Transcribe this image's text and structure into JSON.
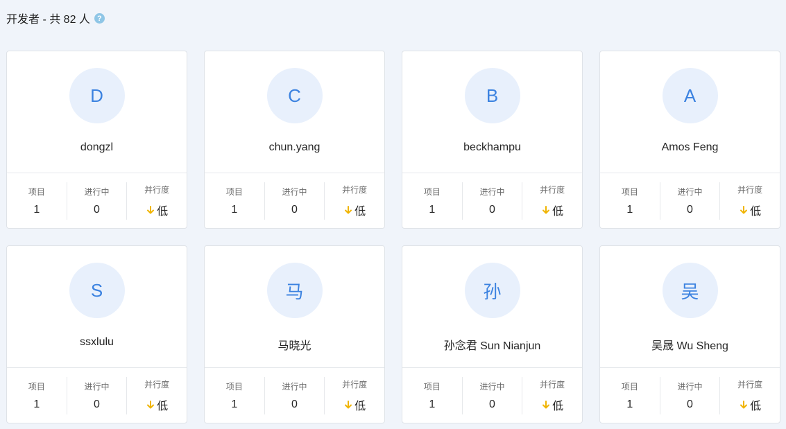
{
  "header": {
    "title": "开发者 - 共 82 人",
    "help_icon": "question-circle-icon",
    "help_symbol": "?"
  },
  "colors": {
    "accent": "#3b82e0",
    "avatar_bg": "#e8f0fc",
    "arrow": "#f0b400",
    "page_bg": "#f0f4fa"
  },
  "stat_labels": {
    "projects": "项目",
    "in_progress": "进行中",
    "parallelism": "并行度"
  },
  "developers": [
    {
      "initial": "D",
      "name": "dongzl",
      "projects": "1",
      "in_progress": "0",
      "parallelism": "低"
    },
    {
      "initial": "C",
      "name": "chun.yang",
      "projects": "1",
      "in_progress": "0",
      "parallelism": "低"
    },
    {
      "initial": "B",
      "name": "beckhampu",
      "projects": "1",
      "in_progress": "0",
      "parallelism": "低"
    },
    {
      "initial": "A",
      "name": "Amos Feng",
      "projects": "1",
      "in_progress": "0",
      "parallelism": "低"
    },
    {
      "initial": "S",
      "name": "ssxlulu",
      "projects": "1",
      "in_progress": "0",
      "parallelism": "低"
    },
    {
      "initial": "马",
      "name": "马晓光",
      "projects": "1",
      "in_progress": "0",
      "parallelism": "低"
    },
    {
      "initial": "孙",
      "name": "孙念君 Sun Nianjun",
      "projects": "1",
      "in_progress": "0",
      "parallelism": "低"
    },
    {
      "initial": "吴",
      "name": "吴晟 Wu Sheng",
      "projects": "1",
      "in_progress": "0",
      "parallelism": "低"
    }
  ]
}
